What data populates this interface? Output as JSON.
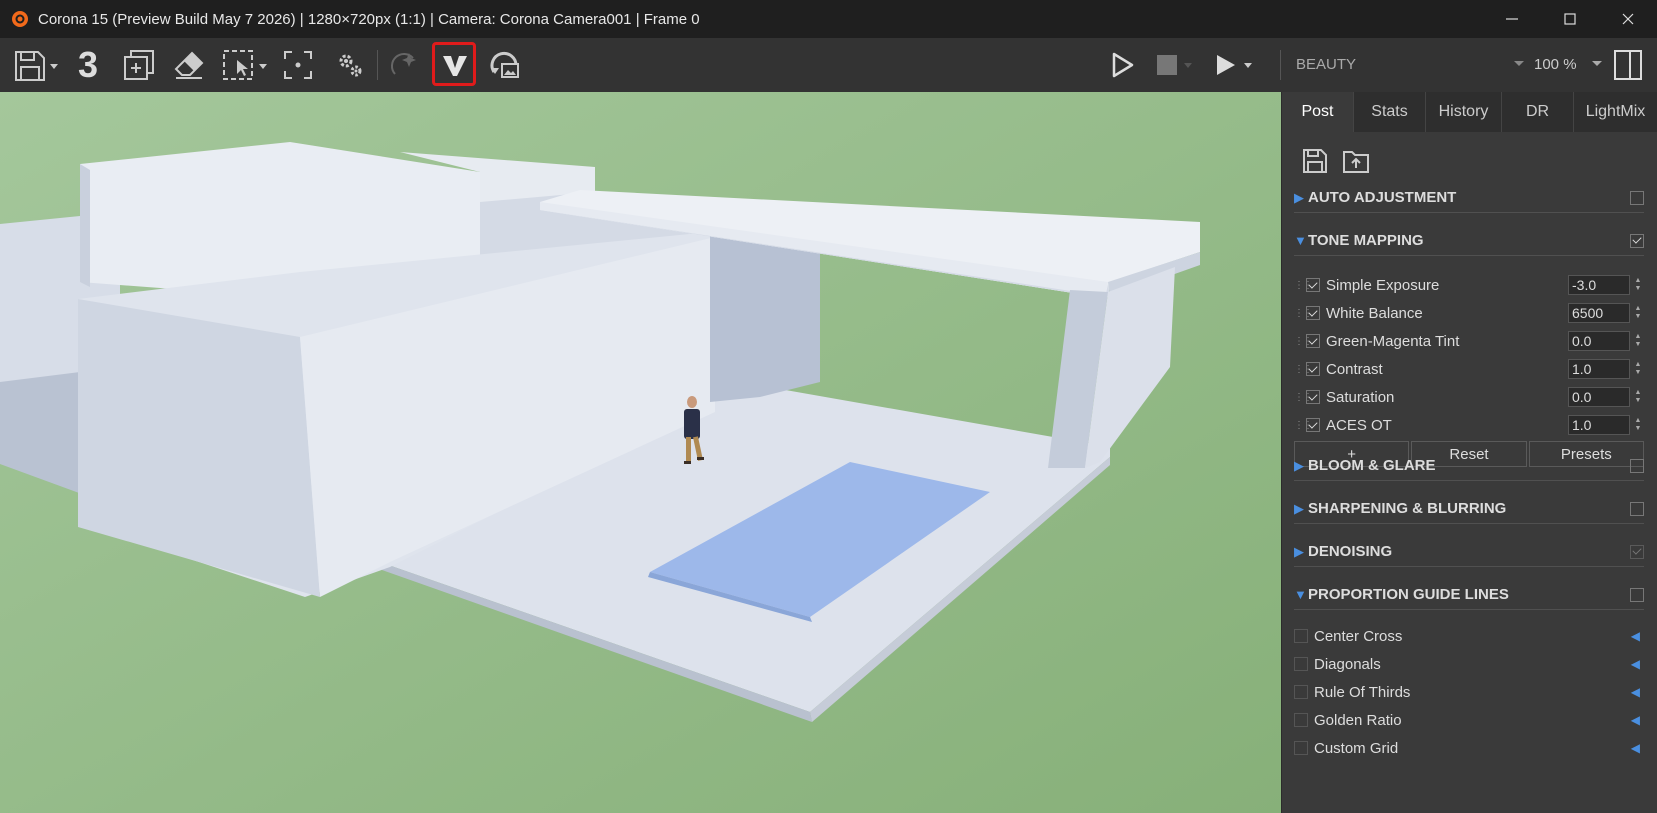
{
  "window": {
    "title": "Corona 15 (Preview Build May 7 2026) | 1280×720px (1:1) | Camera: Corona Camera001 | Frame 0",
    "minimize": "—",
    "maximize": "☐",
    "close": "✕"
  },
  "toolbar": {
    "render_count_label": "3",
    "pass_select": "BEAUTY",
    "zoom_select": "100 %"
  },
  "tabs": [
    {
      "label": "Post"
    },
    {
      "label": "Stats"
    },
    {
      "label": "History"
    },
    {
      "label": "DR"
    },
    {
      "label": "LightMix"
    }
  ],
  "sections": {
    "auto_adjustment": {
      "label": "AUTO ADJUSTMENT",
      "enabled": false
    },
    "tone_mapping": {
      "label": "TONE MAPPING",
      "enabled": true
    },
    "bloom_glare": {
      "label": "BLOOM & GLARE",
      "enabled": false
    },
    "sharpening": {
      "label": "SHARPENING & BLURRING",
      "enabled": false
    },
    "denoising": {
      "label": "DENOISING",
      "enabled": true
    },
    "guide_lines": {
      "label": "PROPORTION GUIDE LINES",
      "enabled": false
    }
  },
  "tone_ops": [
    {
      "label": "Simple Exposure",
      "value": "-3.0",
      "checked": true
    },
    {
      "label": "White Balance",
      "value": "6500",
      "checked": true
    },
    {
      "label": "Green-Magenta Tint",
      "value": "0.0",
      "checked": true
    },
    {
      "label": "Contrast",
      "value": "1.0",
      "checked": true
    },
    {
      "label": "Saturation",
      "value": "0.0",
      "checked": true
    },
    {
      "label": "ACES OT",
      "value": "1.0",
      "checked": true
    }
  ],
  "tone_buttons": {
    "add": "+",
    "reset": "Reset",
    "presets": "Presets"
  },
  "guides": [
    {
      "label": "Center Cross"
    },
    {
      "label": "Diagonals"
    },
    {
      "label": "Rule Of Thirds"
    },
    {
      "label": "Golden Ratio"
    },
    {
      "label": "Custom Grid"
    }
  ],
  "colors": {
    "accent": "#4a8fe0",
    "highlight": "#e01b1b",
    "ground": "#8fb883",
    "pool": "#9db8ea"
  }
}
